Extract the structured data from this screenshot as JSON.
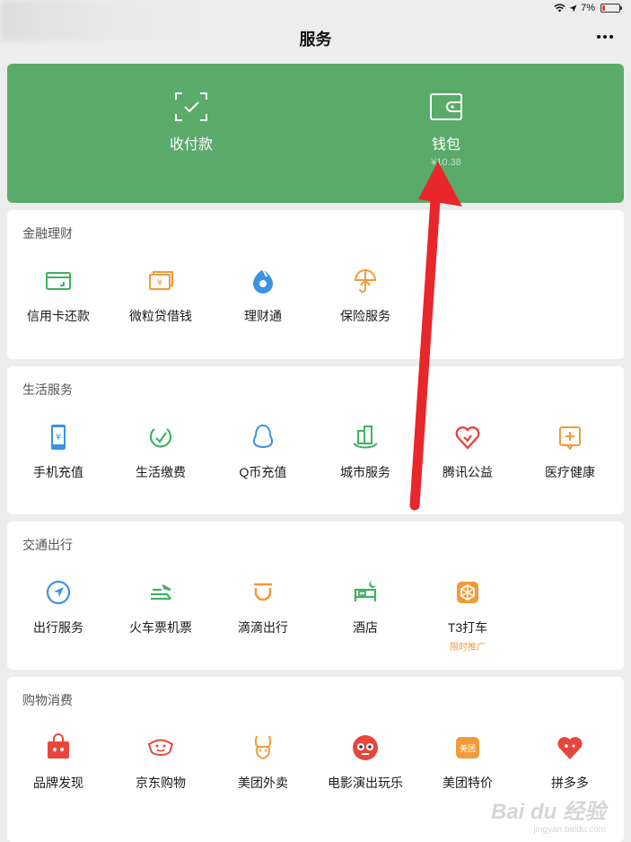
{
  "status": {
    "battery_text": "7%"
  },
  "nav": {
    "title": "服务"
  },
  "hero": {
    "pay_label": "收付款",
    "wallet_label": "钱包",
    "wallet_balance": "¥10.38"
  },
  "sections": [
    {
      "title": "金融理财",
      "items": [
        {
          "label": "信用卡还款",
          "icon": "credit-card-icon"
        },
        {
          "label": "微粒贷借钱",
          "icon": "loan-icon"
        },
        {
          "label": "理财通",
          "icon": "wealth-icon"
        },
        {
          "label": "保险服务",
          "icon": "insurance-icon"
        }
      ]
    },
    {
      "title": "生活服务",
      "items": [
        {
          "label": "手机充值",
          "icon": "phone-recharge-icon"
        },
        {
          "label": "生活缴费",
          "icon": "utility-payment-icon"
        },
        {
          "label": "Q币充值",
          "icon": "qq-coin-icon"
        },
        {
          "label": "城市服务",
          "icon": "city-service-icon"
        },
        {
          "label": "腾讯公益",
          "icon": "charity-icon"
        },
        {
          "label": "医疗健康",
          "icon": "medical-icon"
        }
      ]
    },
    {
      "title": "交通出行",
      "items": [
        {
          "label": "出行服务",
          "icon": "travel-icon"
        },
        {
          "label": "火车票机票",
          "icon": "train-ticket-icon"
        },
        {
          "label": "滴滴出行",
          "icon": "didi-icon"
        },
        {
          "label": "酒店",
          "icon": "hotel-icon"
        },
        {
          "label": "T3打车",
          "icon": "t3-taxi-icon",
          "tag": "限时推广"
        }
      ]
    },
    {
      "title": "购物消费",
      "items": [
        {
          "label": "品牌发现",
          "icon": "brand-icon"
        },
        {
          "label": "京东购物",
          "icon": "jd-icon"
        },
        {
          "label": "美团外卖",
          "icon": "meituan-delivery-icon"
        },
        {
          "label": "电影演出玩乐",
          "icon": "movie-icon"
        },
        {
          "label": "美团特价",
          "icon": "meituan-deal-icon",
          "icon_text": "美团"
        },
        {
          "label": "拼多多",
          "icon": "pinduoduo-icon"
        }
      ]
    }
  ],
  "watermark": {
    "main": "Bai du 经验",
    "sub": "jingyan.baidu.com"
  },
  "colors": {
    "green": "#5aaa6a",
    "blue": "#3b93e6",
    "orange": "#f29b38",
    "red": "#e8463c",
    "arrow": "#e8262b"
  }
}
